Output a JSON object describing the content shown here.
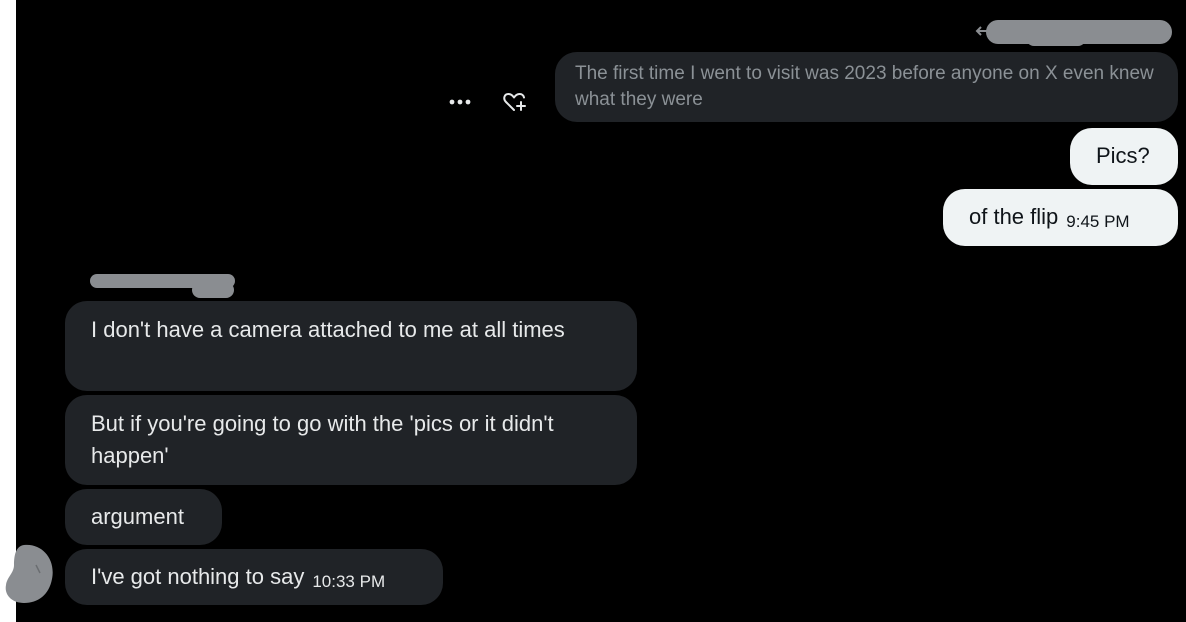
{
  "quoted_message": {
    "text": "The first time I went to visit was 2023 before anyone on X even knew what they were"
  },
  "actions": {
    "more_icon": "more-horizontal-icon",
    "react_icon": "heart-add-icon"
  },
  "sent_messages": [
    {
      "text": "Pics?"
    },
    {
      "text": "of the flip",
      "time": "9:45 PM"
    }
  ],
  "received_messages": [
    {
      "text": "I don't have a camera attached to me at all times"
    },
    {
      "text": "But if you're going to go with the 'pics or it didn't happen'"
    },
    {
      "text": "argument"
    },
    {
      "text": "I've got nothing to say",
      "time": "10:33 PM"
    }
  ],
  "colors": {
    "background": "#000000",
    "received_bubble": "#202327",
    "sent_bubble": "#eff3f4",
    "redaction": "#8a8d91"
  }
}
